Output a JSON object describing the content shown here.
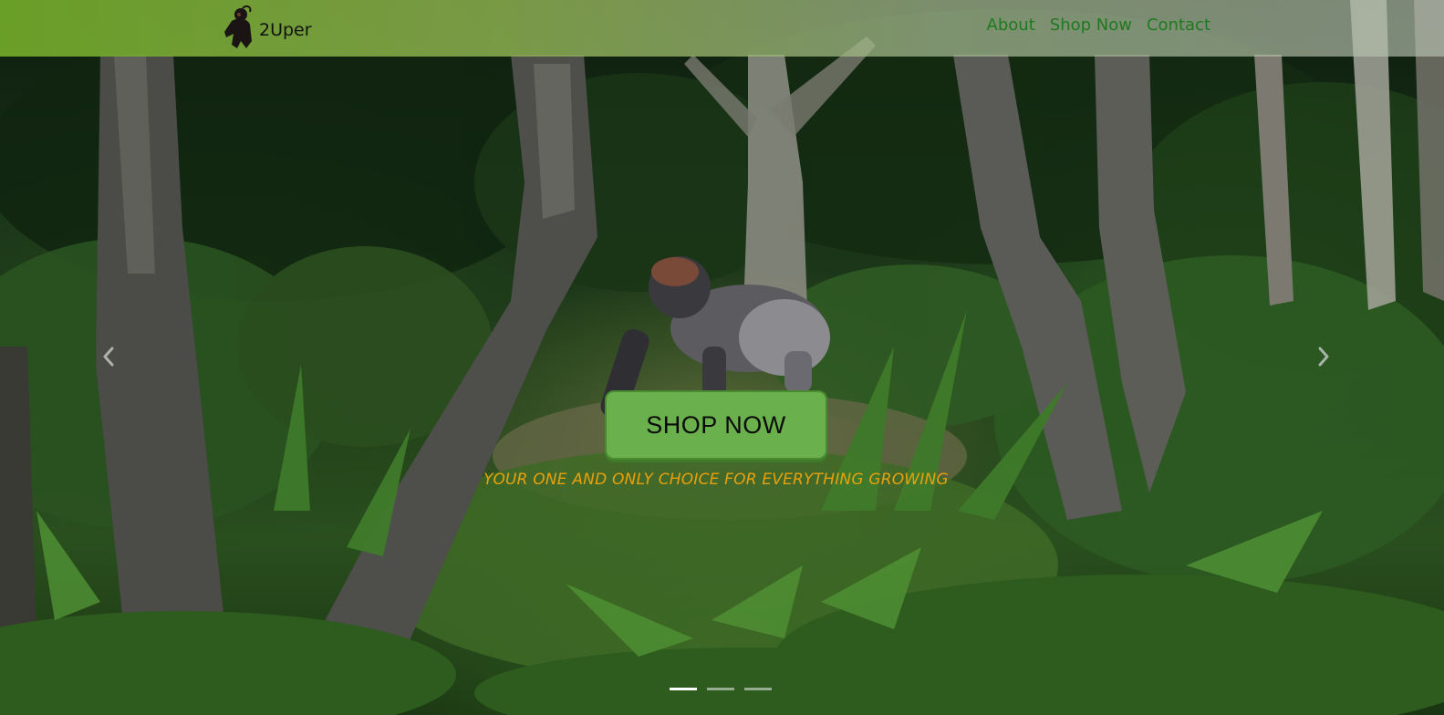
{
  "brand": {
    "name": "2Uper",
    "logo_icon": "gorilla-logo-icon"
  },
  "nav": {
    "links": [
      {
        "label": "About"
      },
      {
        "label": "Shop Now"
      },
      {
        "label": "Contact"
      }
    ]
  },
  "hero": {
    "background": "jungle-with-gorilla-photo",
    "cta_label": "SHOP NOW",
    "tagline": "YOUR ONE AND ONLY CHOICE FOR EVERYTHING GROWING",
    "prev_icon": "chevron-left-icon",
    "next_icon": "chevron-right-icon",
    "slides_count": 3,
    "active_slide": 1
  },
  "colors": {
    "navbar_green": "#6ea528",
    "nav_link": "#1f7a1f",
    "cta_green": "#6ab04c",
    "tagline_orange": "#e8a10c"
  }
}
